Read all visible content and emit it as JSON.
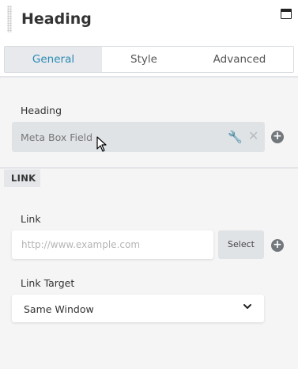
{
  "header": {
    "title": "Heading",
    "drag_icon": "drag-handle-icon",
    "window_icon": "maximize-window-icon"
  },
  "tabs": [
    {
      "label": "General",
      "active": true
    },
    {
      "label": "Style",
      "active": false
    },
    {
      "label": "Advanced",
      "active": false
    }
  ],
  "heading_field": {
    "label": "Heading",
    "value": "Meta Box Field",
    "icons": [
      "wrench-icon",
      "close-icon",
      "plus-circle-icon"
    ]
  },
  "link_section": {
    "title": "LINK",
    "link": {
      "label": "Link",
      "placeholder": "http://www.example.com",
      "select_label": "Select"
    },
    "link_target": {
      "label": "Link Target",
      "value": "Same Window"
    }
  },
  "colors": {
    "accent": "#2a8ab5",
    "background": "#f5f5f5",
    "field_bg": "#e0e3e6"
  }
}
